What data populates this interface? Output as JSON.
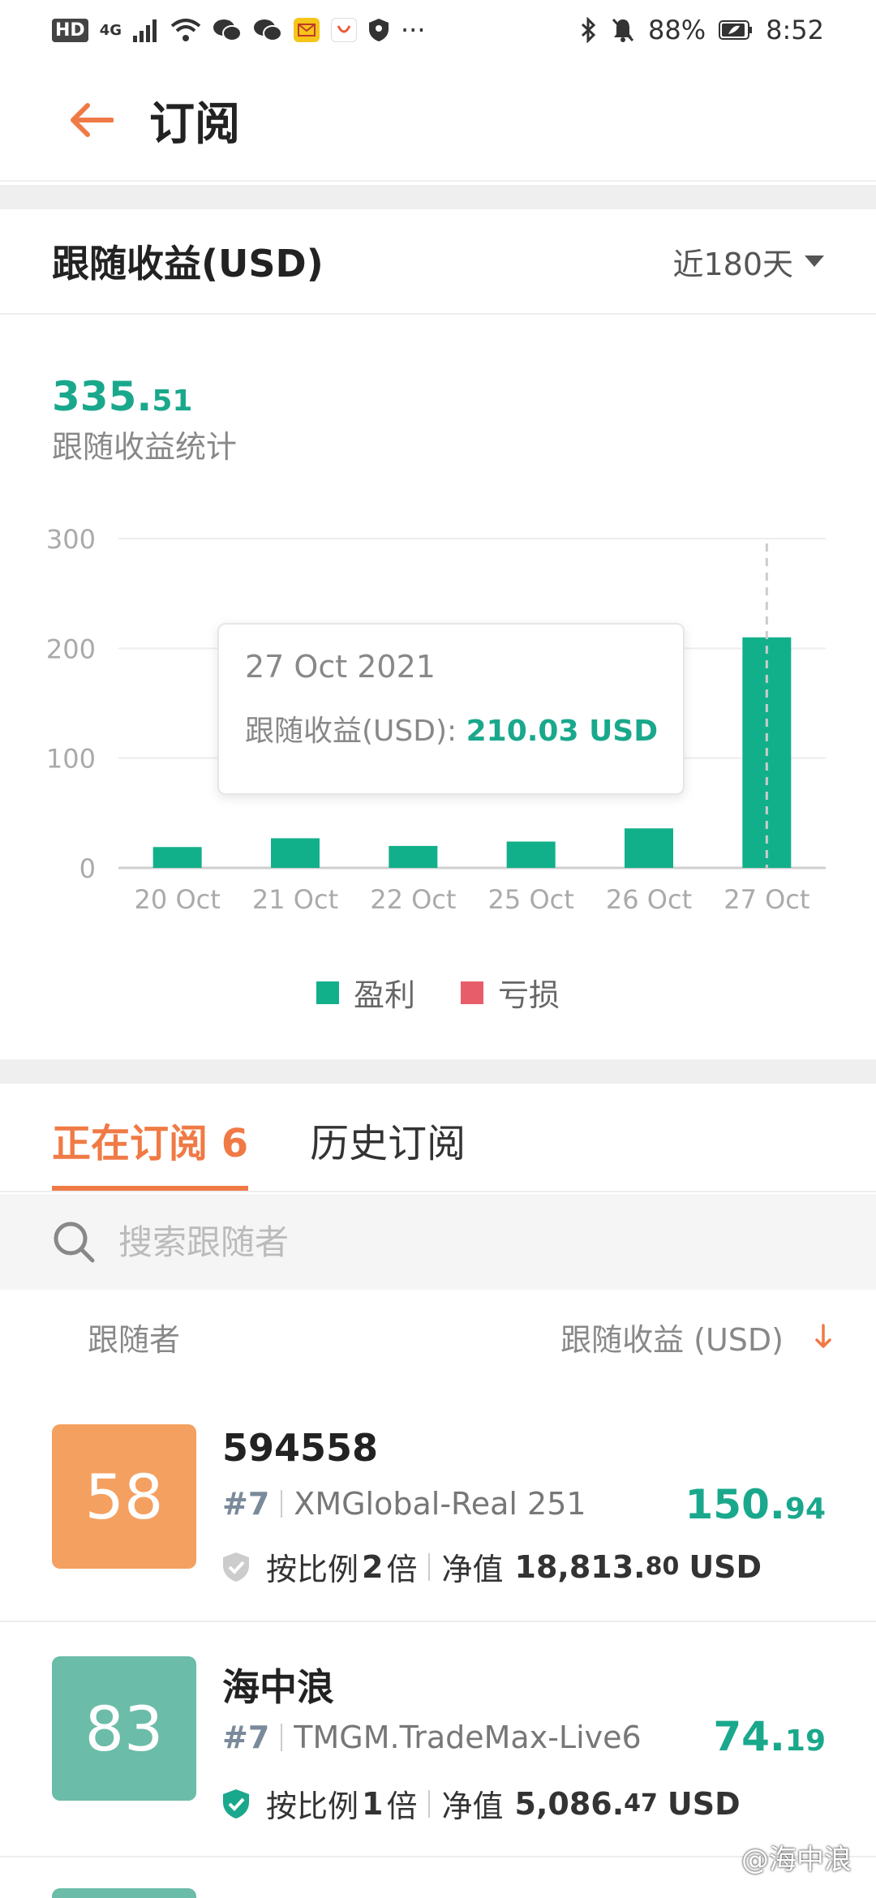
{
  "status_bar": {
    "left_items": [
      "HD",
      "4G"
    ],
    "battery": "88%",
    "time": "8:52",
    "more": "···"
  },
  "header": {
    "title": "订阅"
  },
  "earnings": {
    "title": "跟随收益(USD)",
    "range": "近180天",
    "total_int": "335.",
    "total_dec": "51",
    "total_label": "跟随收益统计"
  },
  "chart_data": {
    "type": "bar",
    "categories": [
      "20 Oct",
      "21 Oct",
      "22 Oct",
      "25 Oct",
      "26 Oct",
      "27 Oct"
    ],
    "values": [
      19,
      27,
      20,
      24,
      36,
      210.03
    ],
    "yticks": [
      0,
      100,
      200,
      300
    ],
    "ylim": [
      0,
      300
    ],
    "grid": true,
    "highlight_index": 5,
    "colors": {
      "profit": "#12b08a",
      "loss": "#e85d6a"
    },
    "legend": [
      {
        "label": "盈利",
        "color": "#12b08a"
      },
      {
        "label": "亏损",
        "color": "#e85d6a"
      }
    ],
    "tooltip": {
      "date": "27 Oct 2021",
      "label": "跟随收益(USD):",
      "value": "210.03 USD"
    }
  },
  "tabs": [
    {
      "label": "正在订阅 6",
      "active": true
    },
    {
      "label": "历史订阅",
      "active": false
    }
  ],
  "search": {
    "placeholder": "搜索跟随者"
  },
  "list_header": {
    "left": "跟随者",
    "right": "跟随收益 (USD)"
  },
  "rows": [
    {
      "avatar": "58",
      "avatar_color": "#f4a060",
      "name": "594558",
      "rank": "#7",
      "server": "XMGlobal-Real 251",
      "ratio_label": "按比例",
      "ratio": "2",
      "ratio_unit": "倍",
      "equity_label": "净值",
      "equity_int": "18,813.",
      "equity_dec": "80",
      "equity_unit": "USD",
      "profit_int": "150.",
      "profit_dec": "94",
      "shield_color": "#cccccc"
    },
    {
      "avatar": "83",
      "avatar_color": "#6bbca8",
      "name": "海中浪",
      "rank": "#7",
      "server": "TMGM.TradeMax-Live6",
      "ratio_label": "按比例",
      "ratio": "1",
      "ratio_unit": "倍",
      "equity_label": "净值",
      "equity_int": "5,086.",
      "equity_dec": "47",
      "equity_unit": "USD",
      "profit_int": "74.",
      "profit_dec": "19",
      "shield_color": "#1aa88c"
    }
  ],
  "watermark": "@海中浪"
}
